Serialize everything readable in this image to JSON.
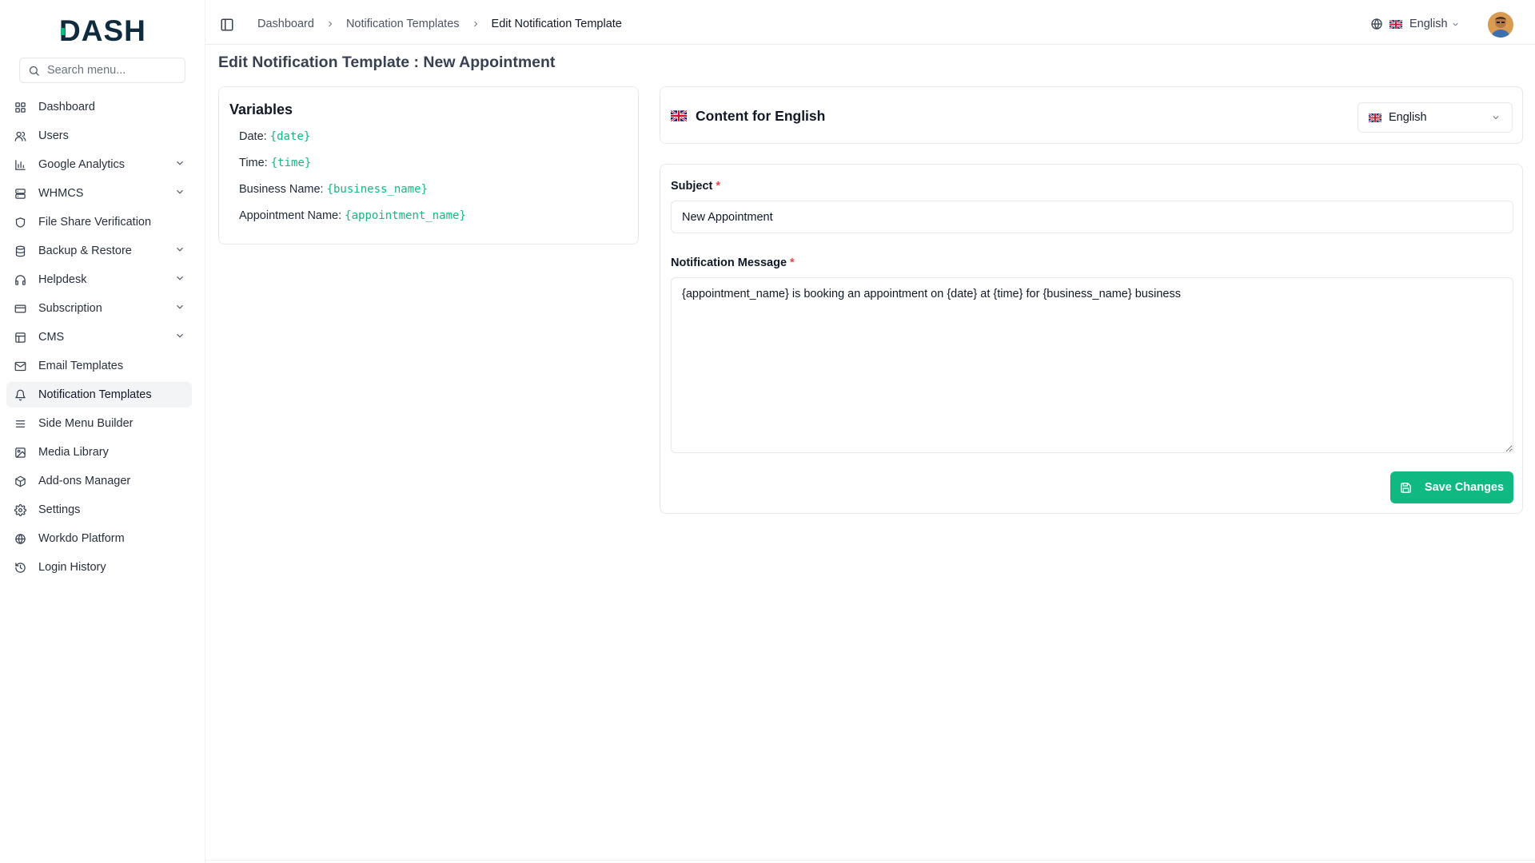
{
  "app": {
    "logo_text": "DASH"
  },
  "sidebar": {
    "search_placeholder": "Search menu...",
    "items": [
      {
        "label": "Dashboard",
        "icon": "dashboard-grid-icon",
        "has_chevron": false,
        "active": false
      },
      {
        "label": "Users",
        "icon": "users-icon",
        "has_chevron": false,
        "active": false
      },
      {
        "label": "Google Analytics",
        "icon": "bar-chart-icon",
        "has_chevron": true,
        "active": false
      },
      {
        "label": "WHMCS",
        "icon": "server-icon",
        "has_chevron": true,
        "active": false
      },
      {
        "label": "File Share Verification",
        "icon": "shield-icon",
        "has_chevron": false,
        "active": false
      },
      {
        "label": "Backup & Restore",
        "icon": "database-icon",
        "has_chevron": true,
        "active": false
      },
      {
        "label": "Helpdesk",
        "icon": "headphones-icon",
        "has_chevron": true,
        "active": false
      },
      {
        "label": "Subscription",
        "icon": "credit-card-icon",
        "has_chevron": true,
        "active": false
      },
      {
        "label": "CMS",
        "icon": "layout-icon",
        "has_chevron": true,
        "active": false
      },
      {
        "label": "Email Templates",
        "icon": "mail-icon",
        "has_chevron": false,
        "active": false
      },
      {
        "label": "Notification Templates",
        "icon": "bell-icon",
        "has_chevron": false,
        "active": true
      },
      {
        "label": "Side Menu Builder",
        "icon": "menu-lines-icon",
        "has_chevron": false,
        "active": false
      },
      {
        "label": "Media Library",
        "icon": "image-icon",
        "has_chevron": false,
        "active": false
      },
      {
        "label": "Add-ons Manager",
        "icon": "package-icon",
        "has_chevron": false,
        "active": false
      },
      {
        "label": "Settings",
        "icon": "gear-icon",
        "has_chevron": false,
        "active": false
      },
      {
        "label": "Workdo Platform",
        "icon": "globe-icon",
        "has_chevron": false,
        "active": false
      },
      {
        "label": "Login History",
        "icon": "history-icon",
        "has_chevron": false,
        "active": false
      }
    ]
  },
  "topbar": {
    "breadcrumb": [
      "Dashboard",
      "Notification Templates",
      "Edit Notification Template"
    ],
    "language": "English"
  },
  "page": {
    "title": "Edit Notification Template : New Appointment"
  },
  "variables": {
    "title": "Variables",
    "items": [
      {
        "label": "Date:",
        "token": "{date}"
      },
      {
        "label": "Time:",
        "token": "{time}"
      },
      {
        "label": "Business Name:",
        "token": "{business_name}"
      },
      {
        "label": "Appointment Name:",
        "token": "{appointment_name}"
      }
    ]
  },
  "content": {
    "title": "Content for English",
    "language_select": "English"
  },
  "form": {
    "subject_label": "Subject",
    "subject_value": "New Appointment",
    "message_label": "Notification Message",
    "message_value": "{appointment_name} is booking an appointment on {date} at {time} for {business_name} business",
    "required_mark": "*",
    "save_label": "Save Changes"
  },
  "colors": {
    "accent": "#10b981",
    "logo_dark": "#0f2b3d",
    "required": "#ef4444"
  }
}
